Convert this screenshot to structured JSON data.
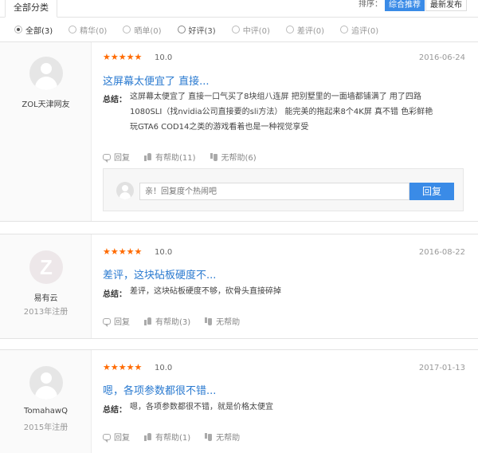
{
  "tabs": {
    "all": "全部分类"
  },
  "sort": {
    "label": "排序：",
    "active": "综合推荐",
    "other": "最新发布"
  },
  "filters": [
    {
      "label": "全部(3)"
    },
    {
      "label": "精华(0)"
    },
    {
      "label": "晒单(0)"
    },
    {
      "label": "好评(3)"
    },
    {
      "label": "中评(0)"
    },
    {
      "label": "差评(0)"
    },
    {
      "label": "追评(0)"
    }
  ],
  "reviews": [
    {
      "user": "ZOL天津网友",
      "registered": "",
      "stars": "★★★★★",
      "score": "10.0",
      "date": "2016-06-24",
      "title": "这屏幕太便宜了 直接...",
      "summary_label": "总结：",
      "summary_lines": [
        "这屏幕太便宜了 直接一口气买了8块组八连屏 把别墅里的一面墙都铺满了 用了四路",
        "1080SLI（找nvidia公司直接要的sli方法） 能完美的拖起来8个4K屏 真不错 色彩鲜艳",
        "玩GTA6 COD14之类的游戏看着也是一种视觉享受"
      ],
      "reply": "回复",
      "helpful": "有帮助(11)",
      "unhelpful": "无帮助(6)"
    },
    {
      "user": "易有云",
      "registered": "2013年注册",
      "stars": "★★★★★",
      "score": "10.0",
      "date": "2016-08-22",
      "title": "差评，这块砧板硬度不...",
      "summary_label": "总结：",
      "summary_lines": [
        "差评，这块砧板硬度不够，砍骨头直接碎掉"
      ],
      "reply": "回复",
      "helpful": "有帮助(3)",
      "unhelpful": "无帮助"
    },
    {
      "user": "TomahawQ",
      "registered": "2015年注册",
      "stars": "★★★★★",
      "score": "10.0",
      "date": "2017-01-13",
      "title": "嗯，各项参数都很不错...",
      "summary_label": "总结：",
      "summary_lines": [
        "嗯，各项参数都很不错，就是价格太便宜"
      ],
      "reply": "回复",
      "helpful": "有帮助(1)",
      "unhelpful": "无帮助"
    }
  ],
  "reply_box": {
    "placeholder": "亲！回复度个热闹吧",
    "button": "回复"
  },
  "colors": {
    "accent": "#3a8be7",
    "star": "#ff6a00",
    "title": "#2a7ad0"
  }
}
